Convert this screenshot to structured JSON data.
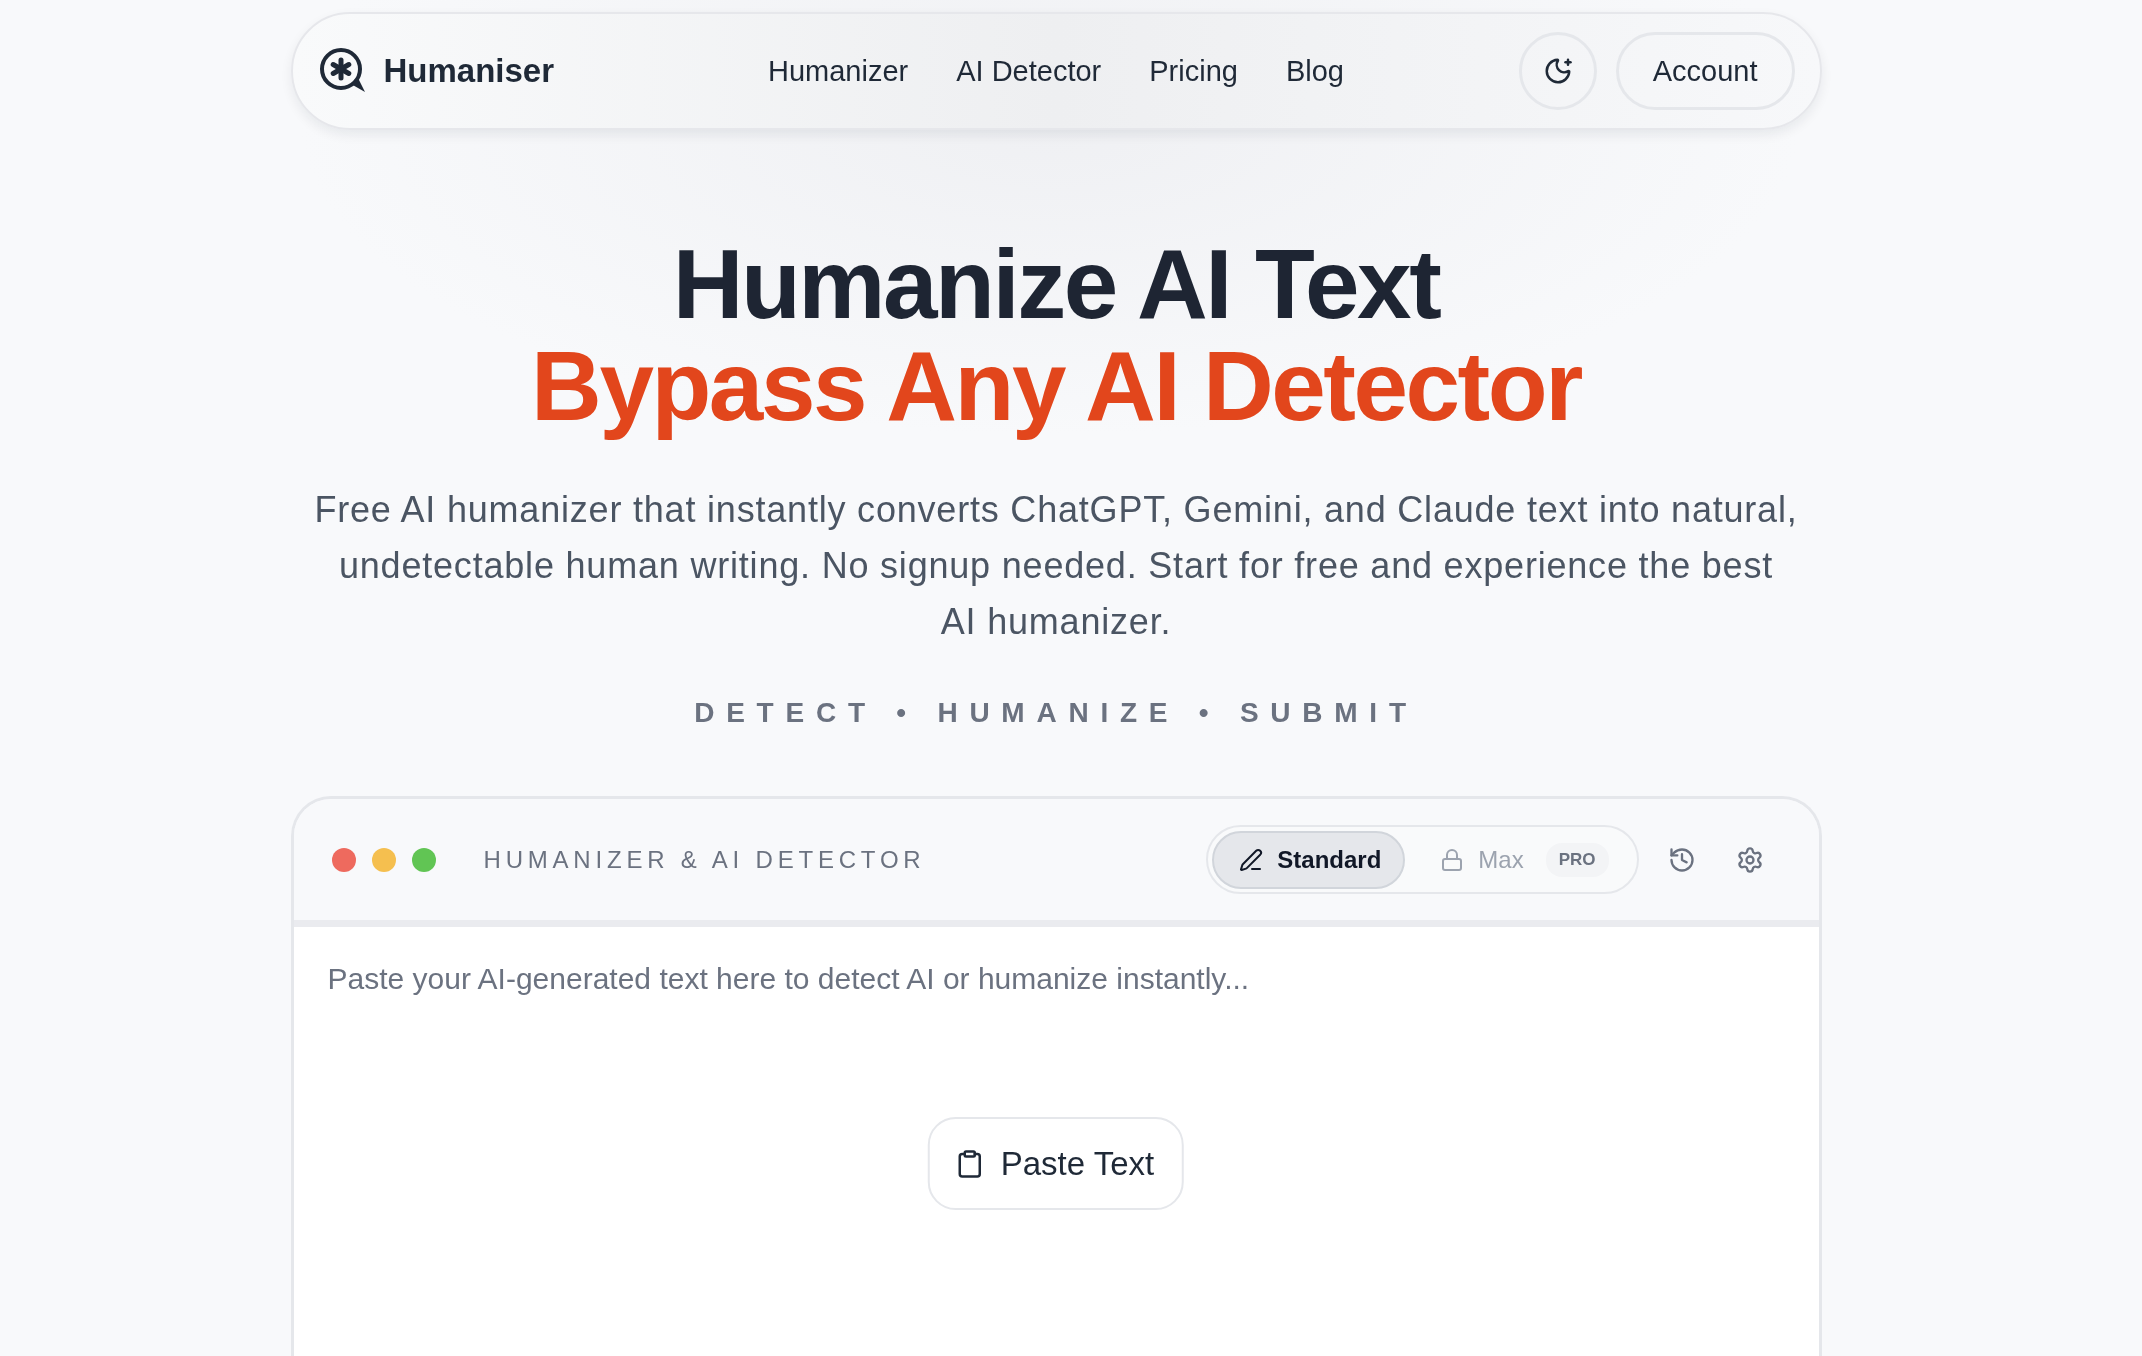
{
  "nav": {
    "brand": "Humaniser",
    "links": [
      "Humanizer",
      "AI Detector",
      "Pricing",
      "Blog"
    ],
    "account_button": "Account"
  },
  "hero": {
    "title": "Humanize AI Text",
    "highlight": "Bypass Any AI Detector",
    "description": "Free AI humanizer that instantly converts ChatGPT, Gemini, and Claude text into natural, undetectable human writing. No signup needed. Start for free and experience the best AI humanizer.",
    "tagline": "DETECT • HUMANIZE • SUBMIT"
  },
  "tool": {
    "window_dots": [
      {
        "color": "#ee6a5e"
      },
      {
        "color": "#f5bf4f"
      },
      {
        "color": "#61c554"
      }
    ],
    "title": "HUMANIZER & AI DETECTOR",
    "modes": [
      {
        "label": "Standard",
        "selected": true,
        "locked": false
      },
      {
        "label": "Max",
        "selected": false,
        "locked": true,
        "badge": "PRO"
      }
    ],
    "input": {
      "placeholder": "Paste your AI-generated text here to detect AI or humanize instantly..."
    },
    "paste_button": "Paste Text"
  }
}
